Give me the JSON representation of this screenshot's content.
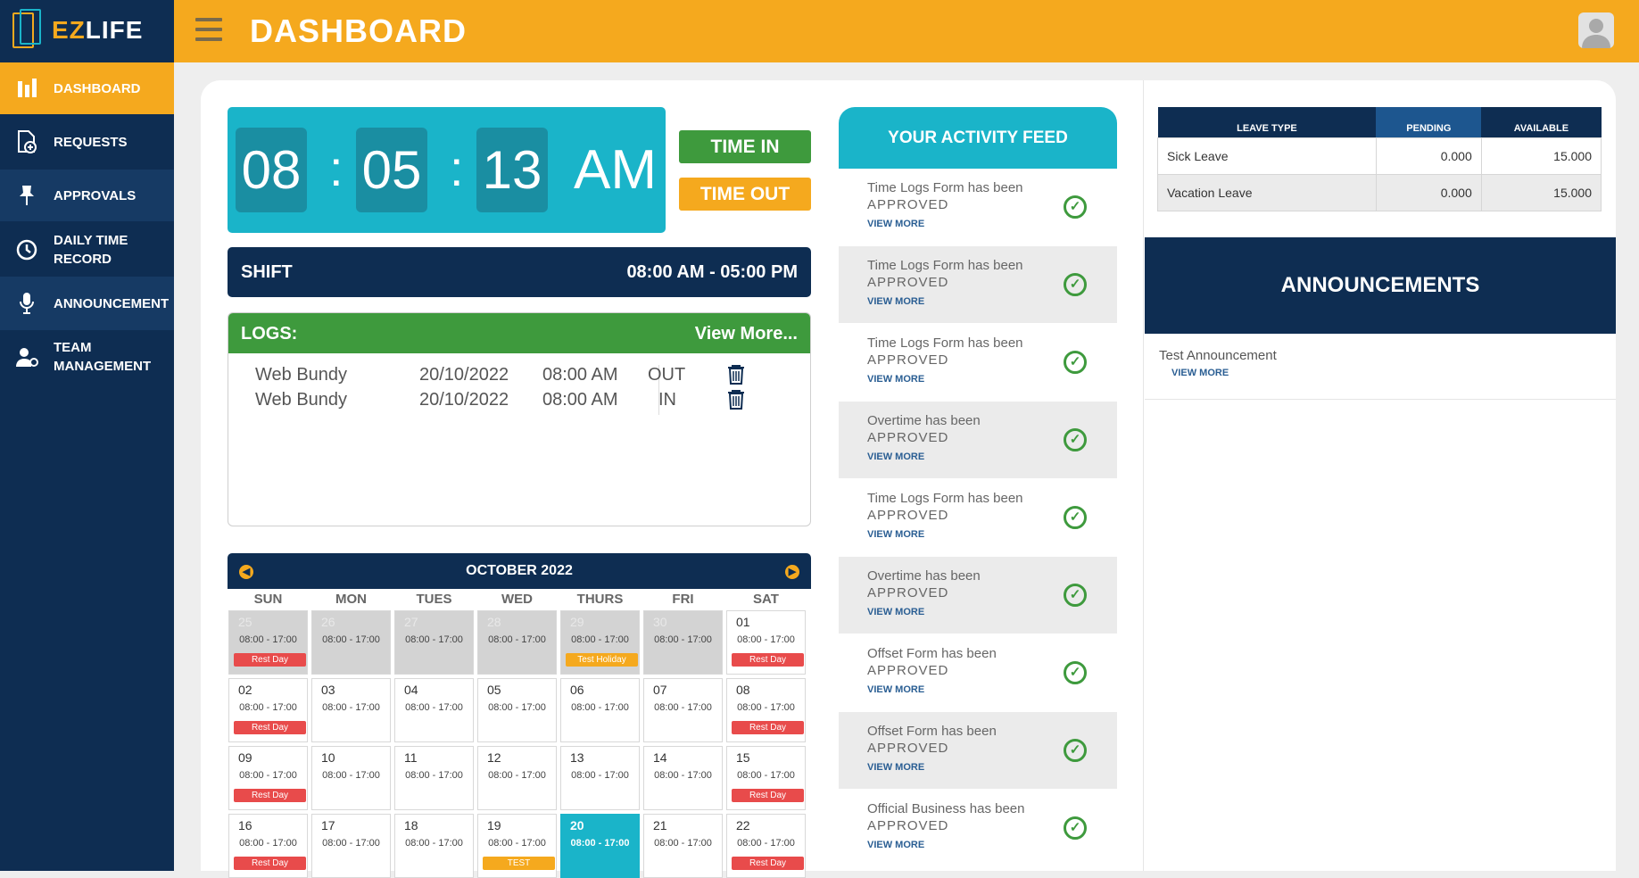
{
  "brand": {
    "ez": "EZ",
    "life": "LIFE"
  },
  "header": {
    "title": "DASHBOARD"
  },
  "sidebar": {
    "items": [
      {
        "label": "DASHBOARD",
        "icon": "bar-chart-icon"
      },
      {
        "label": "REQUESTS",
        "icon": "document-add-icon"
      },
      {
        "label": "APPROVALS",
        "icon": "pin-icon"
      },
      {
        "label": "DAILY TIME RECORD",
        "icon": "clock-icon"
      },
      {
        "label": "ANNOUNCEMENT",
        "icon": "microphone-icon"
      },
      {
        "label": "TEAM MANAGEMENT",
        "icon": "user-gear-icon"
      }
    ]
  },
  "clock": {
    "hh": "08",
    "mm": "05",
    "ss": "13",
    "ampm": "AM",
    "sep": ":"
  },
  "buttons": {
    "time_in": "TIME IN",
    "time_out": "TIME OUT"
  },
  "shift": {
    "label": "SHIFT",
    "value": "08:00 AM - 05:00 PM"
  },
  "logs": {
    "title": "LOGS:",
    "view_more": "View More...",
    "rows": [
      {
        "source": "Web Bundy",
        "date": "20/10/2022",
        "time": "08:00 AM",
        "type": "OUT"
      },
      {
        "source": "Web Bundy",
        "date": "20/10/2022",
        "time": "08:00 AM",
        "type": "IN"
      }
    ]
  },
  "calendar": {
    "month": "OCTOBER 2022",
    "days_of_week": [
      "SUN",
      "MON",
      "TUES",
      "WED",
      "THURS",
      "FRI",
      "SAT"
    ],
    "weeks": [
      [
        {
          "d": "25",
          "t": "08:00 - 17:00",
          "tag": "Rest Day",
          "past": true
        },
        {
          "d": "26",
          "t": "08:00 - 17:00",
          "past": true
        },
        {
          "d": "27",
          "t": "08:00 - 17:00",
          "past": true
        },
        {
          "d": "28",
          "t": "08:00 - 17:00",
          "past": true
        },
        {
          "d": "29",
          "t": "08:00 - 17:00",
          "tag": "Test Holiday",
          "past": true
        },
        {
          "d": "30",
          "t": "08:00 - 17:00",
          "past": true
        },
        {
          "d": "01",
          "t": "08:00 - 17:00",
          "tag": "Rest Day"
        }
      ],
      [
        {
          "d": "02",
          "t": "08:00 - 17:00",
          "tag": "Rest Day"
        },
        {
          "d": "03",
          "t": "08:00 - 17:00"
        },
        {
          "d": "04",
          "t": "08:00 - 17:00"
        },
        {
          "d": "05",
          "t": "08:00 - 17:00"
        },
        {
          "d": "06",
          "t": "08:00 - 17:00"
        },
        {
          "d": "07",
          "t": "08:00 - 17:00"
        },
        {
          "d": "08",
          "t": "08:00 - 17:00",
          "tag": "Rest Day"
        }
      ],
      [
        {
          "d": "09",
          "t": "08:00 - 17:00",
          "tag": "Rest Day"
        },
        {
          "d": "10",
          "t": "08:00 - 17:00"
        },
        {
          "d": "11",
          "t": "08:00 - 17:00"
        },
        {
          "d": "12",
          "t": "08:00 - 17:00"
        },
        {
          "d": "13",
          "t": "08:00 - 17:00"
        },
        {
          "d": "14",
          "t": "08:00 - 17:00"
        },
        {
          "d": "15",
          "t": "08:00 - 17:00",
          "tag": "Rest Day"
        }
      ],
      [
        {
          "d": "16",
          "t": "08:00 - 17:00",
          "tag": "Rest Day"
        },
        {
          "d": "17",
          "t": "08:00 - 17:00"
        },
        {
          "d": "18",
          "t": "08:00 - 17:00"
        },
        {
          "d": "19",
          "t": "08:00 - 17:00",
          "tag": "TEST"
        },
        {
          "d": "20",
          "t": "08:00 - 17:00",
          "today": true
        },
        {
          "d": "21",
          "t": "08:00 - 17:00"
        },
        {
          "d": "22",
          "t": "08:00 - 17:00",
          "tag": "Rest Day"
        }
      ]
    ]
  },
  "feed": {
    "title": "YOUR ACTIVITY FEED",
    "items": [
      {
        "line1": "Time Logs Form has been",
        "line2": "APPROVED",
        "link": "VIEW MORE"
      },
      {
        "line1": "Time Logs Form has been",
        "line2": "APPROVED",
        "link": "VIEW MORE"
      },
      {
        "line1": "Time Logs Form has been",
        "line2": "APPROVED",
        "link": "VIEW MORE"
      },
      {
        "line1": "Overtime has been",
        "line2": "APPROVED",
        "link": "VIEW MORE"
      },
      {
        "line1": "Time Logs Form has been",
        "line2": "APPROVED",
        "link": "VIEW MORE"
      },
      {
        "line1": "Overtime has been",
        "line2": "APPROVED",
        "link": "VIEW MORE"
      },
      {
        "line1": "Offset Form has been",
        "line2": "APPROVED",
        "link": "VIEW MORE"
      },
      {
        "line1": "Offset Form has been",
        "line2": "APPROVED",
        "link": "VIEW MORE"
      },
      {
        "line1": "Official Business has been",
        "line2": "APPROVED",
        "link": "VIEW MORE"
      }
    ]
  },
  "leave": {
    "headers": [
      "LEAVE TYPE",
      "PENDING",
      "AVAILABLE"
    ],
    "rows": [
      {
        "type": "Sick Leave",
        "pending": "0.000",
        "available": "15.000"
      },
      {
        "type": "Vacation Leave",
        "pending": "0.000",
        "available": "15.000"
      }
    ]
  },
  "announcements": {
    "title": "ANNOUNCEMENTS",
    "items": [
      {
        "title": "Test Announcement",
        "link": "VIEW MORE"
      }
    ]
  },
  "colors": {
    "navy": "#0e2d52",
    "orange": "#f5a91e",
    "teal": "#1ab4c9",
    "green": "#3e9a3d",
    "red": "#e84b4b"
  }
}
